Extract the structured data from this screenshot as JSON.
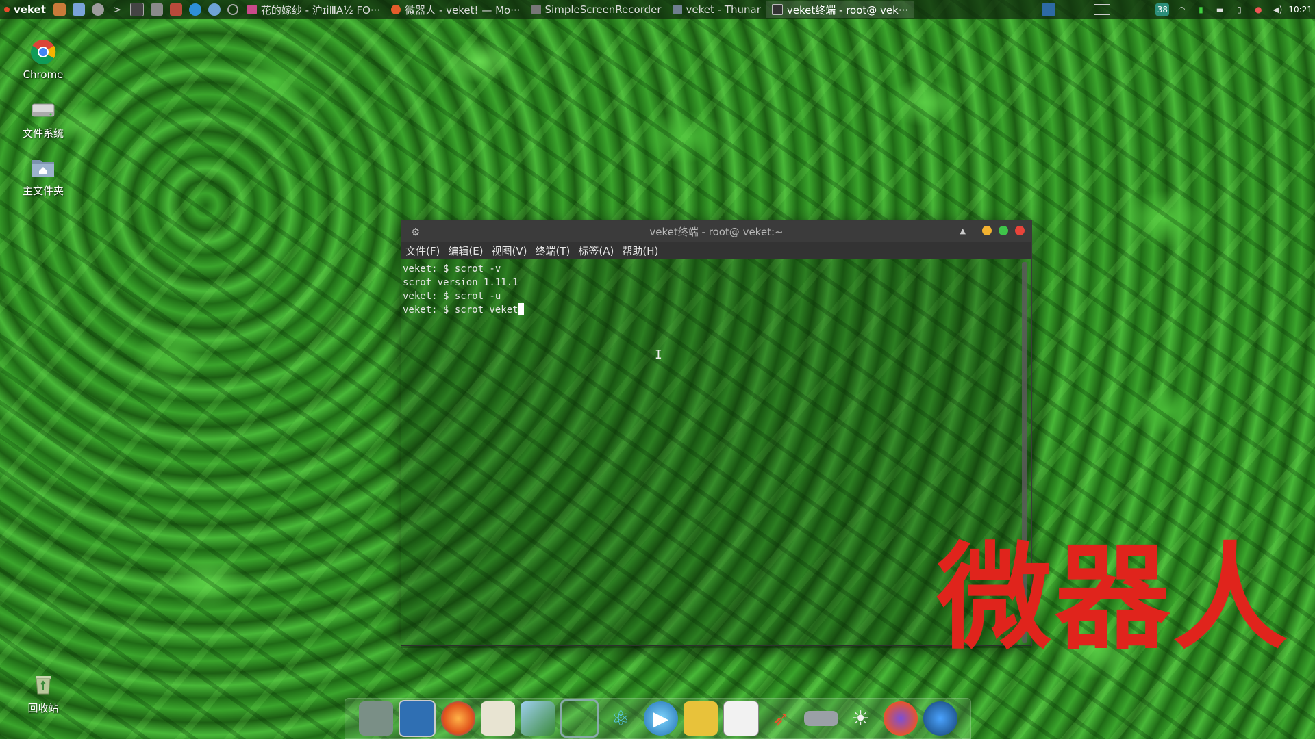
{
  "top_panel": {
    "menu_label": "veket",
    "tasks": [
      "花的嫁纱 - 沪ɪiⅢA½ FO···",
      "微器人 - veket! — Mo···",
      "SimpleScreenRecorder",
      "veket - Thunar",
      "veket终端 - root@ vek···"
    ],
    "battery_badge": "38",
    "clock": "10:21"
  },
  "desktop_icons": [
    {
      "label": "Chrome",
      "icon": "chrome-icon"
    },
    {
      "label": "文件系统",
      "icon": "drive-icon"
    },
    {
      "label": "主文件夹",
      "icon": "home-folder-icon"
    },
    {
      "label": "回收站",
      "icon": "trash-icon"
    }
  ],
  "terminal": {
    "title": "veket终端 - root@ veket:~",
    "menu": [
      "文件(F)",
      "编辑(E)",
      "视图(V)",
      "终端(T)",
      "标签(A)",
      "帮助(H)"
    ],
    "lines": [
      "veket: $ scrot -v",
      "scrot version 1.11.1",
      "veket: $ scrot -u",
      "veket: $ scrot veket"
    ]
  },
  "watermark": "微器人",
  "dock_items": [
    "desktop-icon",
    "monitor-icon",
    "firefox-icon",
    "editor-icon",
    "image-viewer-icon",
    "network-icon",
    "atom-icon",
    "media-player-icon",
    "notes-icon",
    "presentation-icon",
    "rocket-icon",
    "drive-icon",
    "brightness-icon",
    "firefox-icon",
    "globe-icon"
  ],
  "colors": {
    "close": "#e8443a",
    "minimize": "#f2b230",
    "maximize": "#3fc44a",
    "watermark": "#e0241c"
  }
}
